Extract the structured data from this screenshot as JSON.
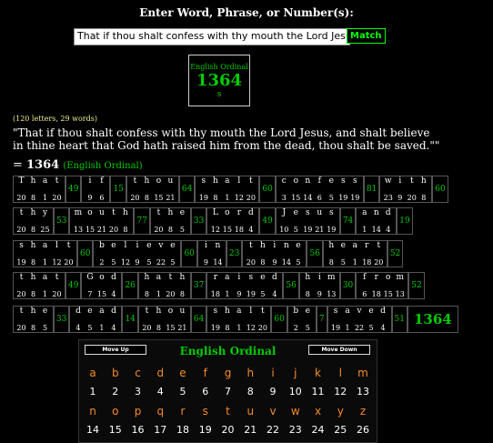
{
  "header": {
    "title": "Enter Word, Phrase, or Number(s):"
  },
  "search": {
    "value": "That if thou shalt confess with thy mouth the Lord Jesus",
    "button": "Match"
  },
  "ordinal_box": {
    "label": "English Ordinal",
    "value": "1364",
    "suffix": "s"
  },
  "counts": "(120 letters, 29 words)",
  "phrase_line1": "\"That if thou shalt confess with thy mouth the Lord Jesus, and shalt believe",
  "phrase_line2": "in thine heart that God hath raised him from the dead, thou shalt be saved.\"\"",
  "total": {
    "prefix": "= ",
    "value": "1364",
    "cipher": "(English Ordinal)"
  },
  "rows": [
    [
      {
        "letters": [
          "T",
          "h",
          "a",
          "t"
        ],
        "nums": [
          "20",
          "8",
          "1",
          "20"
        ],
        "sum": "49"
      },
      {
        "letters": [
          "i",
          "f"
        ],
        "nums": [
          "9",
          "6"
        ],
        "sum": "15"
      },
      {
        "letters": [
          "t",
          "h",
          "o",
          "u"
        ],
        "nums": [
          "20",
          "8",
          "15",
          "21"
        ],
        "sum": "64"
      },
      {
        "letters": [
          "s",
          "h",
          "a",
          "l",
          "t"
        ],
        "nums": [
          "19",
          "8",
          "1",
          "12",
          "20"
        ],
        "sum": "60"
      },
      {
        "letters": [
          "c",
          "o",
          "n",
          "f",
          "e",
          "s",
          "s"
        ],
        "nums": [
          "3",
          "15",
          "14",
          "6",
          "5",
          "19",
          "19"
        ],
        "sum": "81"
      },
      {
        "letters": [
          "w",
          "i",
          "t",
          "h"
        ],
        "nums": [
          "23",
          "9",
          "20",
          "8"
        ],
        "sum": "60"
      }
    ],
    [
      {
        "letters": [
          "t",
          "h",
          "y"
        ],
        "nums": [
          "20",
          "8",
          "25"
        ],
        "sum": "53"
      },
      {
        "letters": [
          "m",
          "o",
          "u",
          "t",
          "h"
        ],
        "nums": [
          "13",
          "15",
          "21",
          "20",
          "8"
        ],
        "sum": "77"
      },
      {
        "letters": [
          "t",
          "h",
          "e"
        ],
        "nums": [
          "20",
          "8",
          "5"
        ],
        "sum": "33"
      },
      {
        "letters": [
          "L",
          "o",
          "r",
          "d"
        ],
        "nums": [
          "12",
          "15",
          "18",
          "4"
        ],
        "sum": "49"
      },
      {
        "letters": [
          "J",
          "e",
          "s",
          "u",
          "s"
        ],
        "nums": [
          "10",
          "5",
          "19",
          "21",
          "19"
        ],
        "sum": "74"
      },
      {
        "letters": [
          "a",
          "n",
          "d"
        ],
        "nums": [
          "1",
          "14",
          "4"
        ],
        "sum": "19"
      }
    ],
    [
      {
        "letters": [
          "s",
          "h",
          "a",
          "l",
          "t"
        ],
        "nums": [
          "19",
          "8",
          "1",
          "12",
          "20"
        ],
        "sum": "60"
      },
      {
        "letters": [
          "b",
          "e",
          "l",
          "i",
          "e",
          "v",
          "e"
        ],
        "nums": [
          "2",
          "5",
          "12",
          "9",
          "5",
          "22",
          "5"
        ],
        "sum": "60"
      },
      {
        "letters": [
          "i",
          "n"
        ],
        "nums": [
          "9",
          "14"
        ],
        "sum": "23"
      },
      {
        "letters": [
          "t",
          "h",
          "i",
          "n",
          "e"
        ],
        "nums": [
          "20",
          "8",
          "9",
          "14",
          "5"
        ],
        "sum": "56"
      },
      {
        "letters": [
          "h",
          "e",
          "a",
          "r",
          "t"
        ],
        "nums": [
          "8",
          "5",
          "1",
          "18",
          "20"
        ],
        "sum": "52"
      }
    ],
    [
      {
        "letters": [
          "t",
          "h",
          "a",
          "t"
        ],
        "nums": [
          "20",
          "8",
          "1",
          "20"
        ],
        "sum": "49"
      },
      {
        "letters": [
          "G",
          "o",
          "d"
        ],
        "nums": [
          "7",
          "15",
          "4"
        ],
        "sum": "26"
      },
      {
        "letters": [
          "h",
          "a",
          "t",
          "h"
        ],
        "nums": [
          "8",
          "1",
          "20",
          "8"
        ],
        "sum": "37"
      },
      {
        "letters": [
          "r",
          "a",
          "i",
          "s",
          "e",
          "d"
        ],
        "nums": [
          "18",
          "1",
          "9",
          "19",
          "5",
          "4"
        ],
        "sum": "56"
      },
      {
        "letters": [
          "h",
          "i",
          "m"
        ],
        "nums": [
          "8",
          "9",
          "13"
        ],
        "sum": "30"
      },
      {
        "letters": [
          "f",
          "r",
          "o",
          "m"
        ],
        "nums": [
          "6",
          "18",
          "15",
          "13"
        ],
        "sum": "52"
      }
    ],
    [
      {
        "letters": [
          "t",
          "h",
          "e"
        ],
        "nums": [
          "20",
          "8",
          "5"
        ],
        "sum": "33"
      },
      {
        "letters": [
          "d",
          "e",
          "a",
          "d"
        ],
        "nums": [
          "4",
          "5",
          "1",
          "4"
        ],
        "sum": "14"
      },
      {
        "letters": [
          "t",
          "h",
          "o",
          "u"
        ],
        "nums": [
          "20",
          "8",
          "15",
          "21"
        ],
        "sum": "64"
      },
      {
        "letters": [
          "s",
          "h",
          "a",
          "l",
          "t"
        ],
        "nums": [
          "19",
          "8",
          "1",
          "12",
          "20"
        ],
        "sum": "60"
      },
      {
        "letters": [
          "b",
          "e"
        ],
        "nums": [
          "2",
          "5"
        ],
        "sum": "7"
      },
      {
        "letters": [
          "s",
          "a",
          "v",
          "e",
          "d"
        ],
        "nums": [
          "19",
          "1",
          "22",
          "5",
          "4"
        ],
        "sum": "51"
      }
    ]
  ],
  "grand_total": "1364",
  "cipher": {
    "move_up": "Move Up",
    "move_down": "Move Down",
    "title": "English Ordinal",
    "letters1": [
      "a",
      "b",
      "c",
      "d",
      "e",
      "f",
      "g",
      "h",
      "i",
      "j",
      "k",
      "l",
      "m"
    ],
    "nums1": [
      "1",
      "2",
      "3",
      "4",
      "5",
      "6",
      "7",
      "8",
      "9",
      "10",
      "11",
      "12",
      "13"
    ],
    "letters2": [
      "n",
      "o",
      "p",
      "q",
      "r",
      "s",
      "t",
      "u",
      "v",
      "w",
      "x",
      "y",
      "z"
    ],
    "nums2": [
      "14",
      "15",
      "16",
      "17",
      "18",
      "19",
      "20",
      "21",
      "22",
      "23",
      "24",
      "25",
      "26"
    ]
  }
}
